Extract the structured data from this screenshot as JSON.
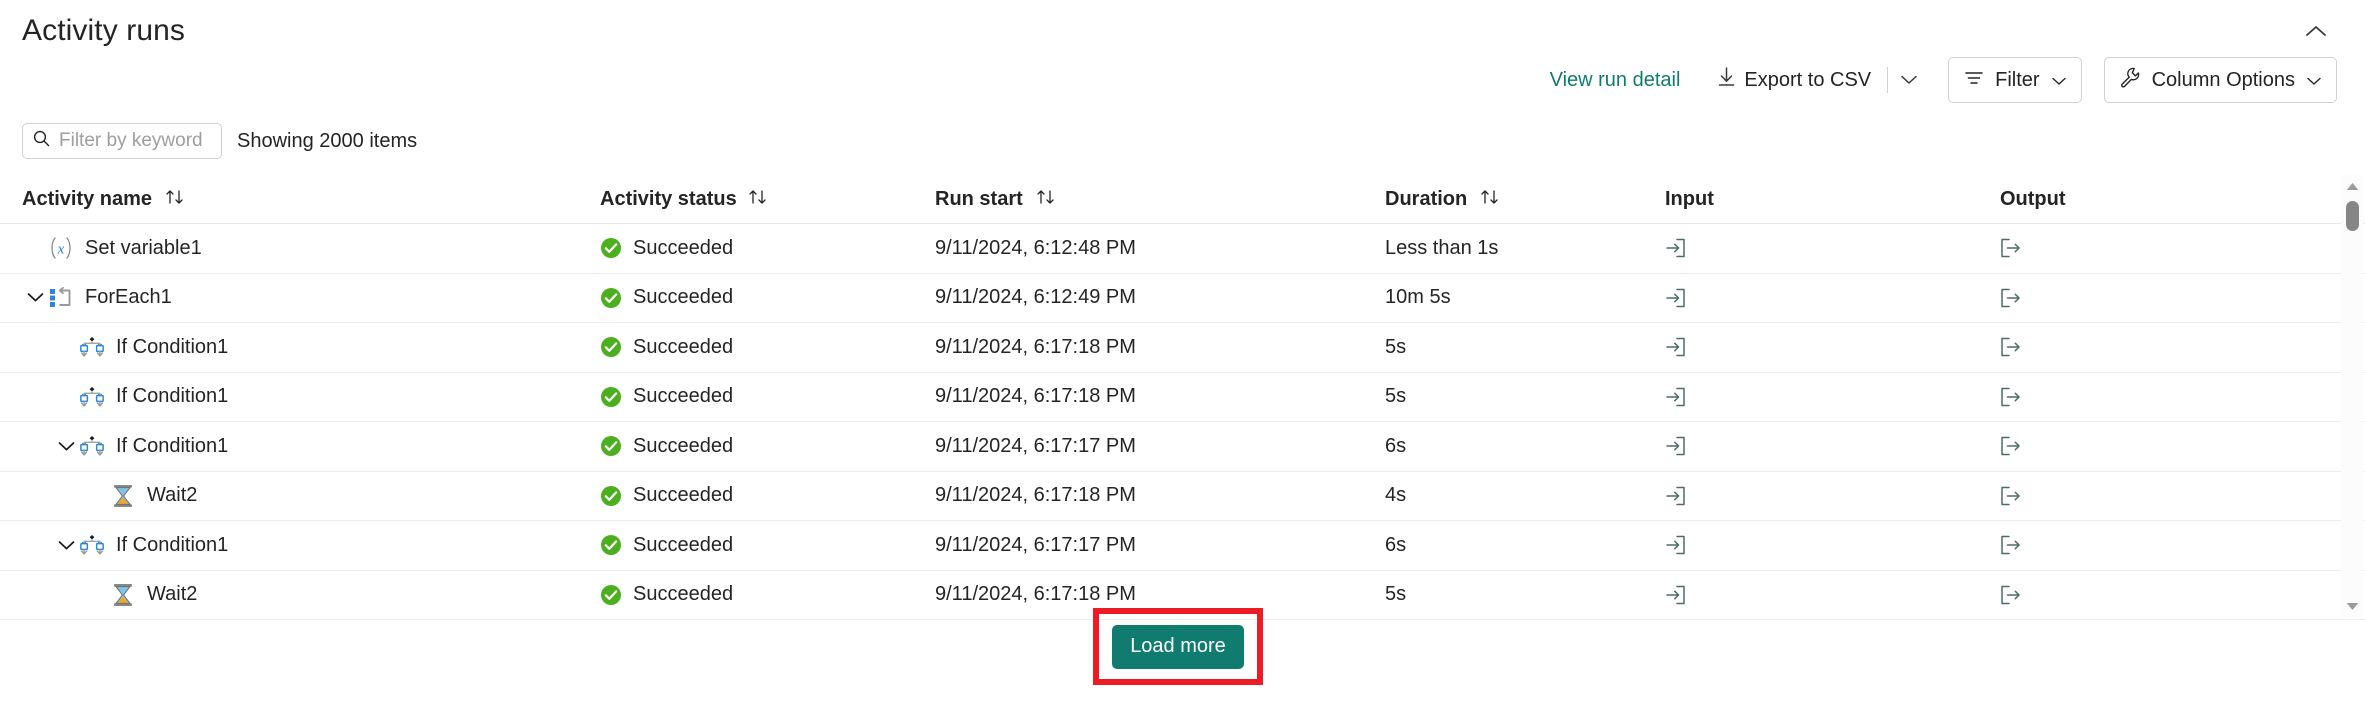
{
  "panel": {
    "title": "Activity runs",
    "collapse_icon": "chevron-up-icon"
  },
  "commandbar": {
    "view_run_detail": "View run detail",
    "export_csv": "Export to CSV",
    "export_icon": "download-icon",
    "export_caret_icon": "chevron-down-icon",
    "filter": "Filter",
    "filter_icon": "filter-lines-icon",
    "filter_caret_icon": "chevron-down-icon",
    "column_options": "Column Options",
    "column_options_icon": "wrench-icon",
    "column_options_caret_icon": "chevron-down-icon"
  },
  "search": {
    "placeholder": "Filter by keyword",
    "value": "",
    "icon": "search-icon"
  },
  "status_text": "Showing 2000 items",
  "colors": {
    "accent_teal": "#107c6f",
    "link_teal": "#107c6f",
    "highlight_red": "#ed1c24",
    "success_green": "#4caf20",
    "icon_blue": "#2b88d8"
  },
  "table": {
    "columns": [
      {
        "key": "activity_name",
        "label": "Activity name",
        "sortable": true
      },
      {
        "key": "activity_status",
        "label": "Activity status",
        "sortable": true
      },
      {
        "key": "run_start",
        "label": "Run start",
        "sortable": true
      },
      {
        "key": "duration",
        "label": "Duration",
        "sortable": true
      },
      {
        "key": "input",
        "label": "Input",
        "sortable": false
      },
      {
        "key": "output",
        "label": "Output",
        "sortable": false
      }
    ],
    "rows": [
      {
        "name": "Set variable1",
        "icon": "set-variable-icon",
        "indent": 0,
        "expandable": false,
        "expanded": false,
        "status": "Succeeded",
        "status_icon": "success-check-icon",
        "run_start": "9/11/2024, 6:12:48 PM",
        "duration": "Less than 1s",
        "input_icon": "input-arrow-icon",
        "output_icon": "output-arrow-icon"
      },
      {
        "name": "ForEach1",
        "icon": "foreach-icon",
        "indent": 0,
        "expandable": true,
        "expanded": true,
        "status": "Succeeded",
        "status_icon": "success-check-icon",
        "run_start": "9/11/2024, 6:12:49 PM",
        "duration": "10m 5s",
        "input_icon": "input-arrow-icon",
        "output_icon": "output-arrow-icon"
      },
      {
        "name": "If Condition1",
        "icon": "if-condition-icon",
        "indent": 1,
        "expandable": false,
        "expanded": false,
        "status": "Succeeded",
        "status_icon": "success-check-icon",
        "run_start": "9/11/2024, 6:17:18 PM",
        "duration": "5s",
        "input_icon": "input-arrow-icon",
        "output_icon": "output-arrow-icon"
      },
      {
        "name": "If Condition1",
        "icon": "if-condition-icon",
        "indent": 1,
        "expandable": false,
        "expanded": false,
        "status": "Succeeded",
        "status_icon": "success-check-icon",
        "run_start": "9/11/2024, 6:17:18 PM",
        "duration": "5s",
        "input_icon": "input-arrow-icon",
        "output_icon": "output-arrow-icon"
      },
      {
        "name": "If Condition1",
        "icon": "if-condition-icon",
        "indent": 1,
        "expandable": true,
        "expanded": true,
        "status": "Succeeded",
        "status_icon": "success-check-icon",
        "run_start": "9/11/2024, 6:17:17 PM",
        "duration": "6s",
        "input_icon": "input-arrow-icon",
        "output_icon": "output-arrow-icon"
      },
      {
        "name": "Wait2",
        "icon": "hourglass-icon",
        "indent": 2,
        "expandable": false,
        "expanded": false,
        "status": "Succeeded",
        "status_icon": "success-check-icon",
        "run_start": "9/11/2024, 6:17:18 PM",
        "duration": "4s",
        "input_icon": "input-arrow-icon",
        "output_icon": "output-arrow-icon"
      },
      {
        "name": "If Condition1",
        "icon": "if-condition-icon",
        "indent": 1,
        "expandable": true,
        "expanded": true,
        "status": "Succeeded",
        "status_icon": "success-check-icon",
        "run_start": "9/11/2024, 6:17:17 PM",
        "duration": "6s",
        "input_icon": "input-arrow-icon",
        "output_icon": "output-arrow-icon"
      },
      {
        "name": "Wait2",
        "icon": "hourglass-icon",
        "indent": 2,
        "expandable": false,
        "expanded": false,
        "status": "Succeeded",
        "status_icon": "success-check-icon",
        "run_start": "9/11/2024, 6:17:18 PM",
        "duration": "5s",
        "input_icon": "input-arrow-icon",
        "output_icon": "output-arrow-icon"
      }
    ]
  },
  "footer": {
    "load_more": "Load more",
    "highlighted": true
  },
  "scrollbar": {
    "up_arrow_icon": "scroll-up-icon",
    "down_arrow_icon": "scroll-down-icon"
  }
}
